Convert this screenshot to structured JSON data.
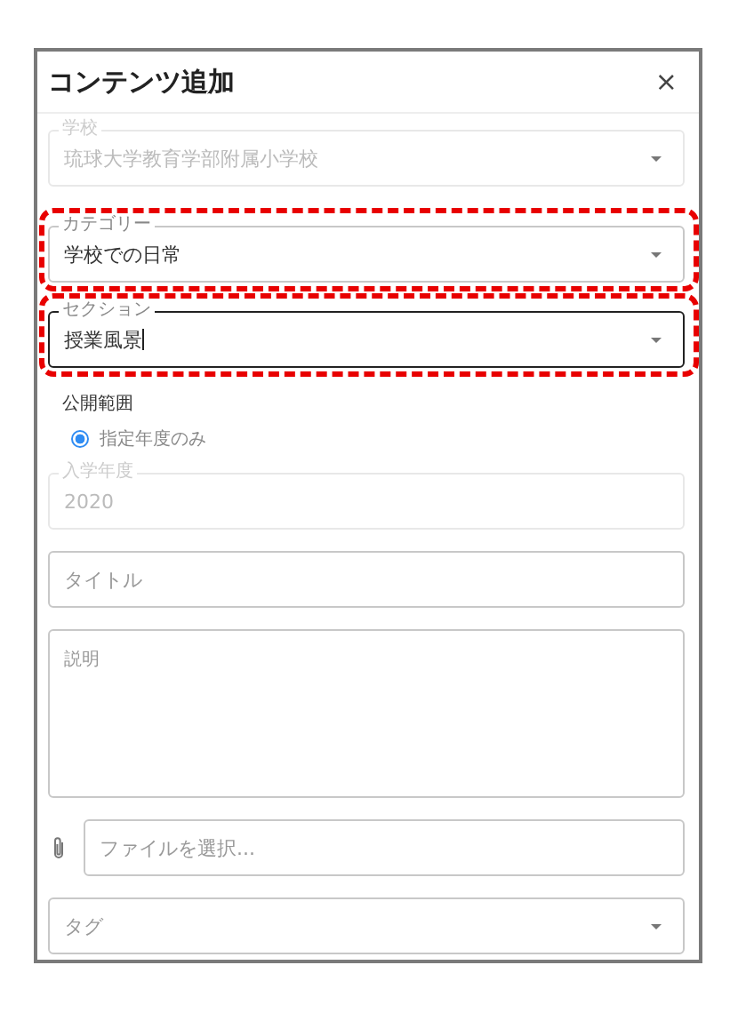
{
  "dialog": {
    "title": "コンテンツ追加",
    "close": "×"
  },
  "fields": [
    {
      "kind": "select",
      "label": "学校",
      "value": "琉球大学教育学部附属小学校",
      "disabled": true,
      "focused": false,
      "highlighted": false
    },
    {
      "kind": "select",
      "label": "カテゴリー",
      "value": "学校での日常",
      "disabled": false,
      "focused": false,
      "highlighted": true
    },
    {
      "kind": "select",
      "label": "セクション",
      "value": "授業風景",
      "disabled": false,
      "focused": true,
      "highlighted": true
    },
    {
      "kind": "radio",
      "label": "公開範囲",
      "options": [
        {
          "label": "指定年度のみ",
          "selected": true
        }
      ]
    },
    {
      "kind": "text",
      "label": "入学年度",
      "value": "2020",
      "disabled": true,
      "focused": false,
      "highlighted": false
    },
    {
      "kind": "text",
      "placeholder": "タイトル",
      "disabled": false,
      "focused": false,
      "highlighted": false
    },
    {
      "kind": "textarea",
      "placeholder": "説明",
      "disabled": false,
      "focused": false,
      "highlighted": false
    },
    {
      "kind": "file",
      "placeholder": "ファイルを選択...",
      "disabled": false,
      "focused": false,
      "highlighted": false
    },
    {
      "kind": "select",
      "placeholder": "タグ",
      "disabled": false,
      "focused": false,
      "highlighted": false
    }
  ]
}
